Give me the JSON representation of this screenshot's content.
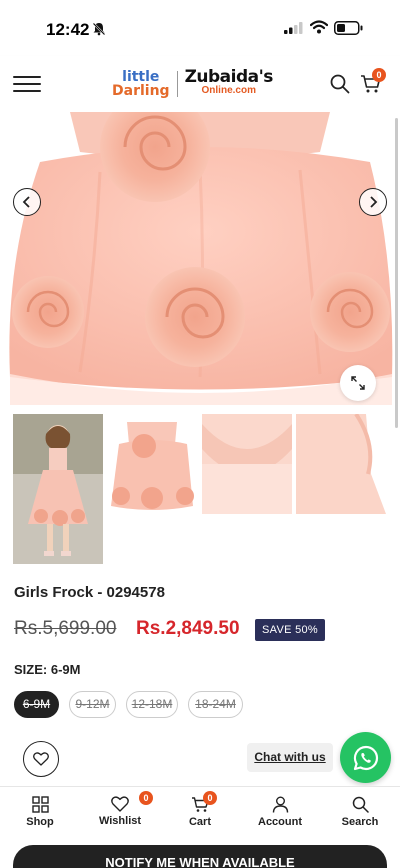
{
  "status_bar": {
    "time": "12:42"
  },
  "header": {
    "logo_left_line1": "little",
    "logo_left_line2": "Darling",
    "logo_right_line1": "Zubaida's",
    "logo_right_line2": "Online.com",
    "cart_count": "0"
  },
  "product": {
    "title": "Girls Frock - 0294578",
    "price_old": "Rs.5,699.00",
    "price_new": "Rs.2,849.50",
    "save_badge": "SAVE 50%",
    "size_label": "SIZE: 6-9M",
    "sizes": [
      "6-9M",
      "9-12M",
      "12-18M",
      "18-24M"
    ],
    "selected_size": "6-9M"
  },
  "chat": {
    "label": "Chat with us"
  },
  "bottom_nav": {
    "shop": "Shop",
    "wishlist": "Wishlist",
    "wishlist_count": "0",
    "cart": "Cart",
    "cart_count": "0",
    "account": "Account",
    "search": "Search"
  },
  "cta": {
    "notify": "NOTIFY ME WHEN AVAILABLE"
  },
  "colors": {
    "accent": "#e8541e",
    "price": "#d6262b",
    "save_bg": "#2b2f59",
    "whatsapp": "#25c363"
  }
}
